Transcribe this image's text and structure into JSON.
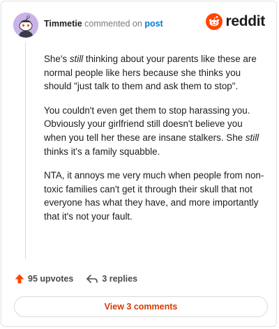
{
  "comment": {
    "username": "Timmetie",
    "action_text": "commented on",
    "post_link": "post",
    "brand_name": "reddit",
    "paragraphs": [
      {
        "parts": [
          "She's ",
          "still",
          " thinking about your parents like these are normal people like hers because she thinks you should \"just talk to them and ask them to stop\"."
        ]
      },
      {
        "parts": [
          "You couldn't even get them to stop harassing you. Obviously your girlfriend still doesn't believe you when you tell her these are insane stalkers. She ",
          "still",
          " thinks it's a family squabble."
        ]
      },
      {
        "parts": [
          "NTA, it annoys me very much when people from non-toxic families can't get it through their skull that not everyone has what they have, and more importantly that it's not your fault."
        ]
      }
    ],
    "upvotes": "95 upvotes",
    "replies": "3 replies",
    "view_button": "View 3 comments"
  },
  "colors": {
    "accent": "#d93a00",
    "link": "#0079d3",
    "upvote": "#ff4500"
  },
  "icons": {
    "avatar": "snoo-avatar",
    "logo": "reddit-logo",
    "upvote": "upvote-arrow-icon",
    "reply": "reply-arrow-icon"
  }
}
